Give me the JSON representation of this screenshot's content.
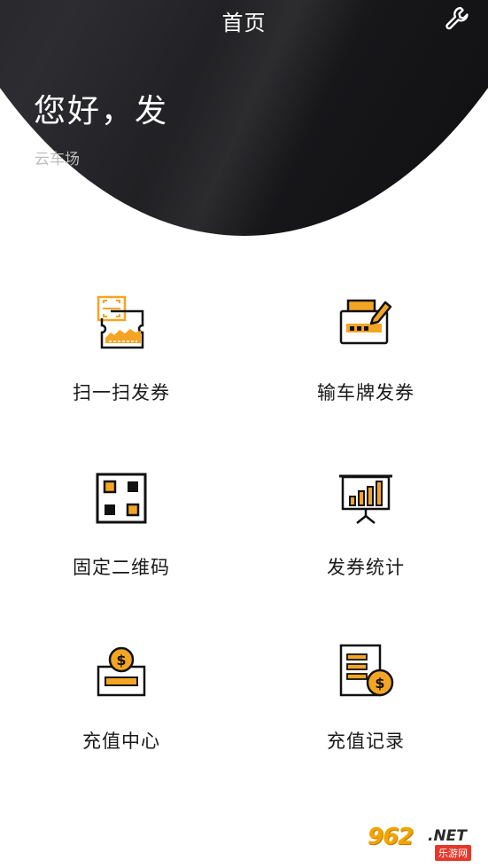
{
  "header": {
    "title": "首页",
    "greeting": "您好，发",
    "subtitle": "云车场",
    "settings_icon": "wrench-icon"
  },
  "menu": [
    {
      "label": "扫一扫发券",
      "icon": "scan-ticket-icon"
    },
    {
      "label": "输车牌发券",
      "icon": "plate-input-icon"
    },
    {
      "label": "固定二维码",
      "icon": "qr-code-icon"
    },
    {
      "label": "发券统计",
      "icon": "statistics-icon"
    },
    {
      "label": "充值中心",
      "icon": "recharge-icon"
    },
    {
      "label": "充值记录",
      "icon": "recharge-record-icon"
    }
  ],
  "watermark": {
    "main": "962",
    "suffix": ".NET",
    "sub": "乐游网"
  },
  "colors": {
    "accent": "#F5A524",
    "dark": "#111111",
    "header_bg": "#1c1c1e"
  }
}
